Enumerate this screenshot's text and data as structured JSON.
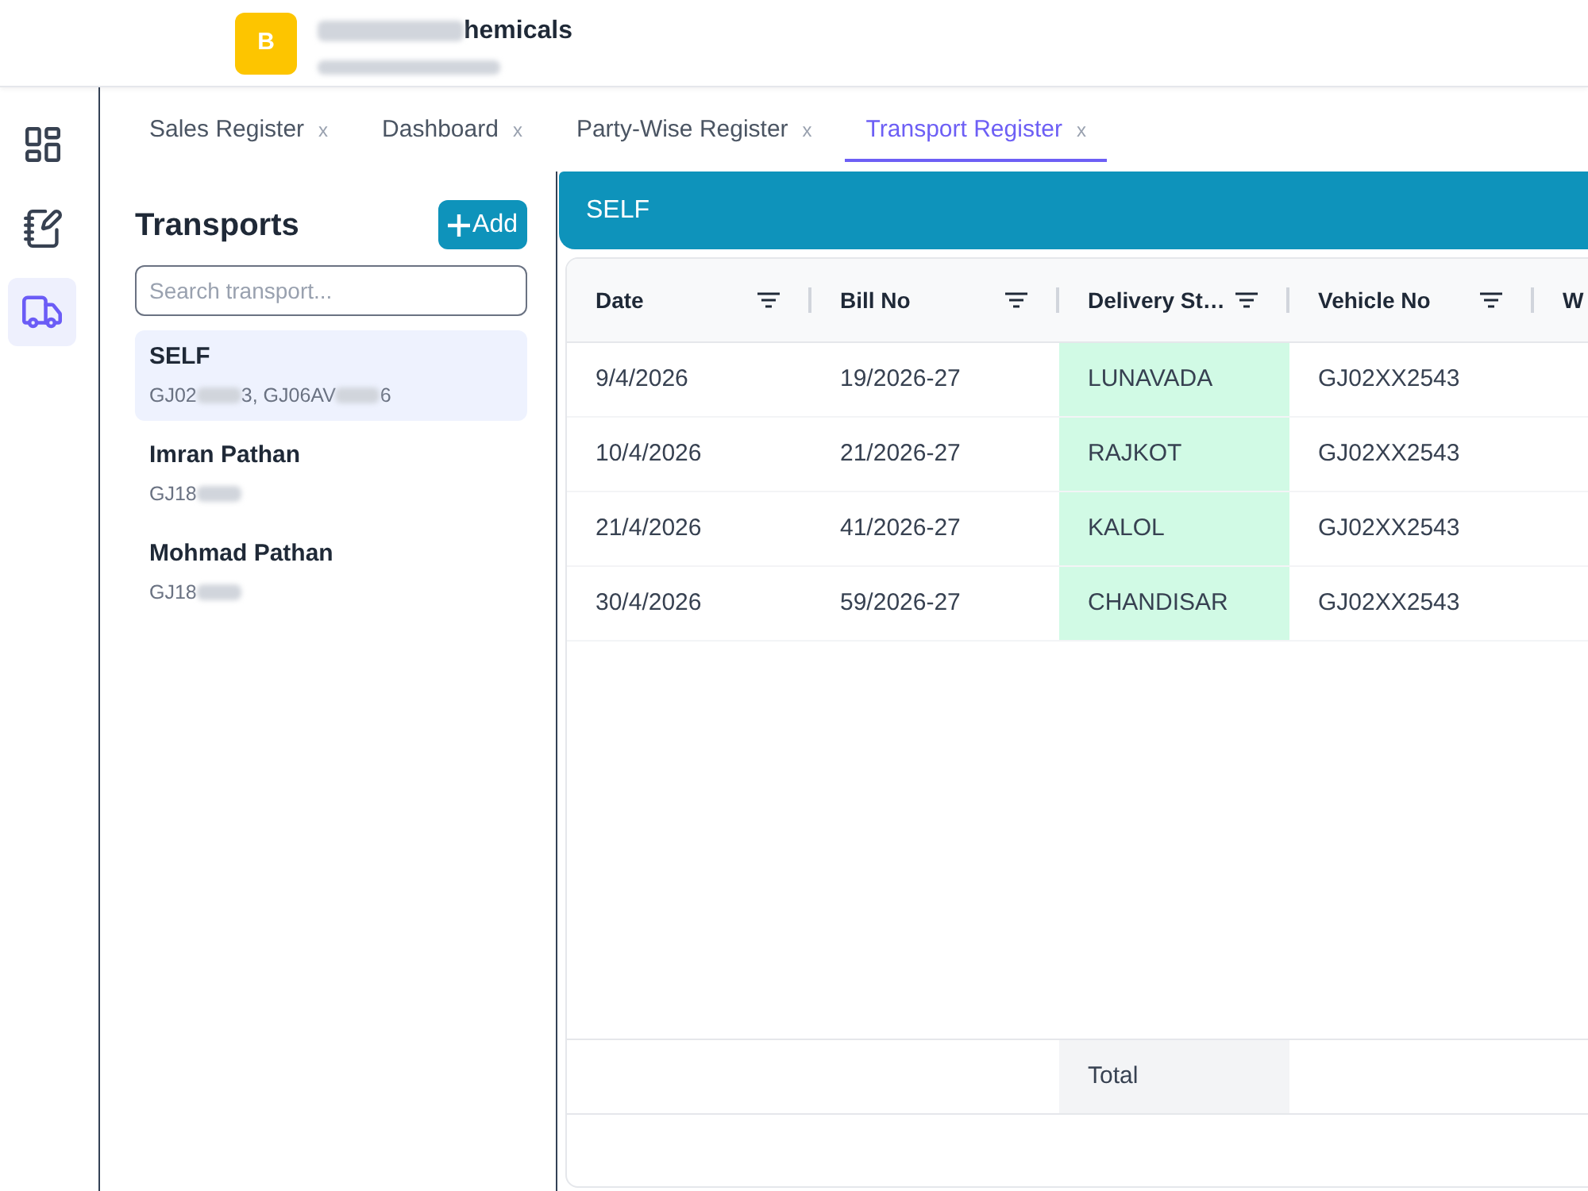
{
  "header": {
    "logo_letter": "B",
    "company_name": [
      {
        "kind": "redacted"
      },
      {
        "kind": "text",
        "text": "hemicals"
      }
    ],
    "company_id": [
      {
        "kind": "redacted"
      }
    ]
  },
  "nav_rail": {
    "items": [
      {
        "kind": "dashboard",
        "selected": false
      },
      {
        "kind": "notebook",
        "selected": false
      },
      {
        "kind": "truck",
        "selected": true
      }
    ]
  },
  "tabs": [
    {
      "label": "Sales Register",
      "close": "x",
      "selected": false
    },
    {
      "label": "Dashboard",
      "close": "x",
      "selected": false
    },
    {
      "label": "Party-Wise Register",
      "close": "x",
      "selected": false
    },
    {
      "label": "Transport Register",
      "close": "x",
      "selected": true
    }
  ],
  "transports_panel": {
    "title": "Transports",
    "add_button": "Add",
    "search": {
      "placeholder": "Search transport..."
    },
    "items": [
      {
        "name": "SELF",
        "selected": true,
        "vehicles": [
          {
            "kind": "text",
            "text": "GJ02"
          },
          {
            "kind": "redacted"
          },
          {
            "kind": "text",
            "text": "3, GJ06AV"
          },
          {
            "kind": "redacted"
          },
          {
            "kind": "text",
            "text": "6"
          }
        ]
      },
      {
        "name": "Imran Pathan",
        "selected": false,
        "vehicles": [
          {
            "kind": "text",
            "text": "GJ18"
          },
          {
            "kind": "redacted"
          }
        ]
      },
      {
        "name": "Mohmad Pathan",
        "selected": false,
        "vehicles": [
          {
            "kind": "text",
            "text": "GJ18"
          },
          {
            "kind": "redacted"
          }
        ]
      }
    ]
  },
  "detail": {
    "title": "SELF"
  },
  "table": {
    "columns": [
      {
        "label": "Date",
        "filter": true
      },
      {
        "label": "Bill No",
        "filter": true
      },
      {
        "label": "Delivery St…",
        "filter": true,
        "highlighted": true,
        "footer": "Total"
      },
      {
        "label": "Vehicle No",
        "filter": true
      },
      {
        "label": "W"
      }
    ],
    "rows": [
      {
        "cells": [
          "9/4/2026",
          "19/2026-27",
          "LUNAVADA",
          "GJ02XX2543"
        ]
      },
      {
        "cells": [
          "10/4/2026",
          "21/2026-27",
          "RAJKOT",
          "GJ02XX2543"
        ]
      },
      {
        "cells": [
          "21/4/2026",
          "41/2026-27",
          "KALOL",
          "GJ02XX2543"
        ]
      },
      {
        "cells": [
          "30/4/2026",
          "59/2026-27",
          "CHANDISAR",
          "GJ02XX2543"
        ]
      }
    ]
  }
}
